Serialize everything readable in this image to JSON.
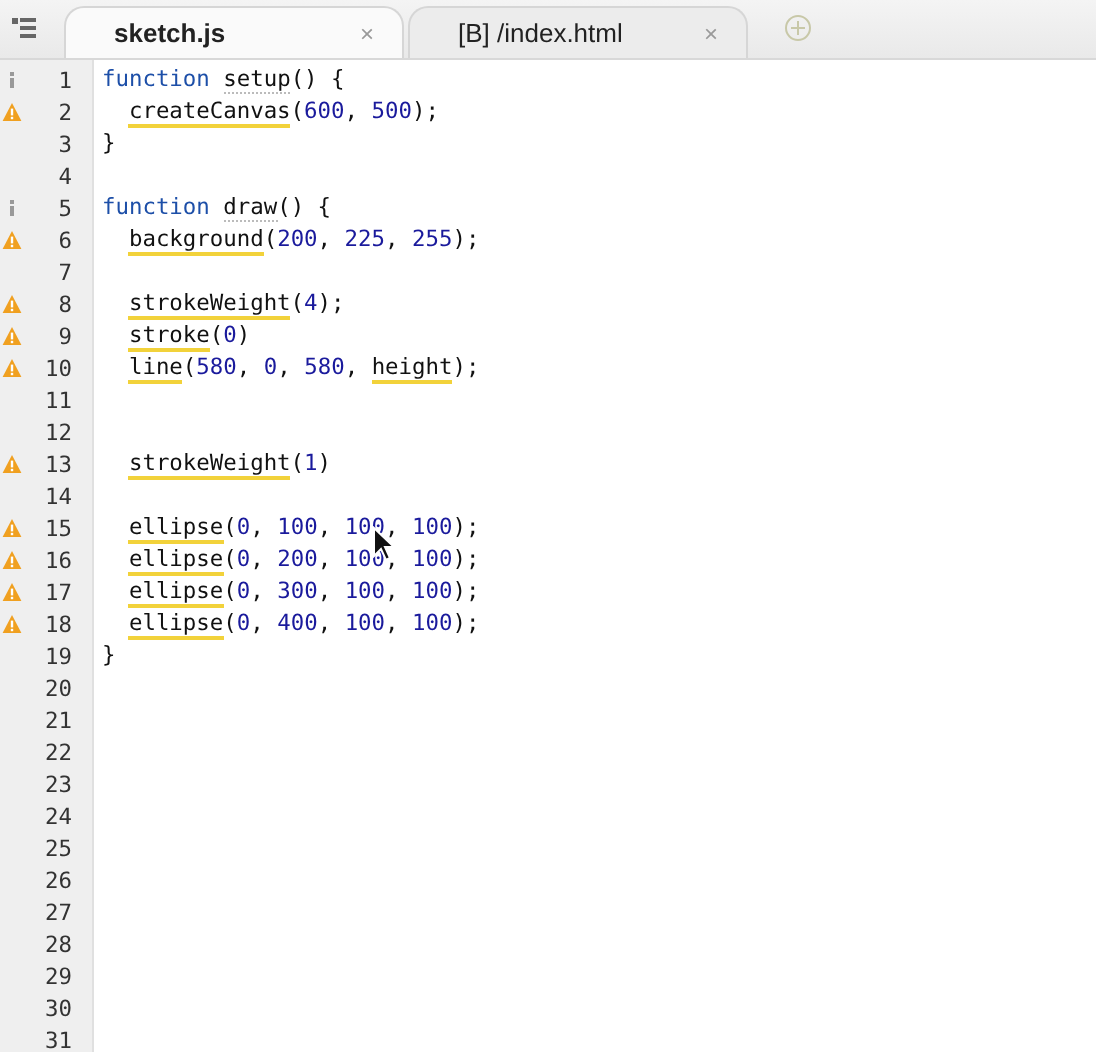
{
  "tabs": [
    {
      "label": "sketch.js",
      "selected": true,
      "close": "×"
    },
    {
      "label": "[B] /index.html",
      "selected": false,
      "close": "×"
    }
  ],
  "editor": {
    "lines": [
      {
        "number": "1",
        "info": true,
        "warning": false,
        "indent": false,
        "tokens": [
          {
            "text": "function ",
            "kind": "keyword"
          },
          {
            "text": "setup",
            "kind": "decl"
          },
          {
            "text": "() {",
            "kind": "text"
          }
        ]
      },
      {
        "number": "2",
        "info": false,
        "warning": true,
        "indent": true,
        "tokens": [
          {
            "text": "createCanvas",
            "kind": "call"
          },
          {
            "text": "(",
            "kind": "text"
          },
          {
            "text": "600",
            "kind": "number"
          },
          {
            "text": ", ",
            "kind": "text"
          },
          {
            "text": "500",
            "kind": "number"
          },
          {
            "text": ");",
            "kind": "text"
          }
        ]
      },
      {
        "number": "3",
        "info": false,
        "warning": false,
        "indent": false,
        "tokens": [
          {
            "text": "}",
            "kind": "text"
          }
        ]
      },
      {
        "number": "4",
        "info": false,
        "warning": false
      },
      {
        "number": "5",
        "info": true,
        "warning": false,
        "indent": false,
        "tokens": [
          {
            "text": "function ",
            "kind": "keyword"
          },
          {
            "text": "draw",
            "kind": "decl"
          },
          {
            "text": "() {",
            "kind": "text"
          }
        ]
      },
      {
        "number": "6",
        "info": false,
        "warning": true,
        "indent": true,
        "tokens": [
          {
            "text": "background",
            "kind": "call"
          },
          {
            "text": "(",
            "kind": "text"
          },
          {
            "text": "200",
            "kind": "number"
          },
          {
            "text": ", ",
            "kind": "text"
          },
          {
            "text": "225",
            "kind": "number"
          },
          {
            "text": ", ",
            "kind": "text"
          },
          {
            "text": "255",
            "kind": "number"
          },
          {
            "text": ");",
            "kind": "text"
          }
        ]
      },
      {
        "number": "7",
        "info": false,
        "warning": false
      },
      {
        "number": "8",
        "info": false,
        "warning": true,
        "indent": true,
        "tokens": [
          {
            "text": "strokeWeight",
            "kind": "call"
          },
          {
            "text": "(",
            "kind": "text"
          },
          {
            "text": "4",
            "kind": "number"
          },
          {
            "text": ");",
            "kind": "text"
          }
        ]
      },
      {
        "number": "9",
        "info": false,
        "warning": true,
        "indent": true,
        "tokens": [
          {
            "text": "stroke",
            "kind": "call"
          },
          {
            "text": "(",
            "kind": "text"
          },
          {
            "text": "0",
            "kind": "number"
          },
          {
            "text": ")",
            "kind": "text"
          }
        ]
      },
      {
        "number": "10",
        "info": false,
        "warning": true,
        "indent": true,
        "tokens": [
          {
            "text": "line",
            "kind": "call"
          },
          {
            "text": "(",
            "kind": "text"
          },
          {
            "text": "580",
            "kind": "number"
          },
          {
            "text": ", ",
            "kind": "text"
          },
          {
            "text": "0",
            "kind": "number"
          },
          {
            "text": ", ",
            "kind": "text"
          },
          {
            "text": "580",
            "kind": "number"
          },
          {
            "text": ", ",
            "kind": "text"
          },
          {
            "text": "height",
            "kind": "call"
          },
          {
            "text": ");",
            "kind": "text"
          }
        ]
      },
      {
        "number": "11",
        "info": false,
        "warning": false
      },
      {
        "number": "12",
        "info": false,
        "warning": false
      },
      {
        "number": "13",
        "info": false,
        "warning": true,
        "indent": true,
        "tokens": [
          {
            "text": "strokeWeight",
            "kind": "call"
          },
          {
            "text": "(",
            "kind": "text"
          },
          {
            "text": "1",
            "kind": "number"
          },
          {
            "text": ")",
            "kind": "text"
          }
        ]
      },
      {
        "number": "14",
        "info": false,
        "warning": false
      },
      {
        "number": "15",
        "info": false,
        "warning": true,
        "indent": true,
        "tokens": [
          {
            "text": "ellipse",
            "kind": "call"
          },
          {
            "text": "(",
            "kind": "text"
          },
          {
            "text": "0",
            "kind": "number"
          },
          {
            "text": ", ",
            "kind": "text"
          },
          {
            "text": "100",
            "kind": "number"
          },
          {
            "text": ", ",
            "kind": "text"
          },
          {
            "text": "100",
            "kind": "number"
          },
          {
            "text": ", ",
            "kind": "text"
          },
          {
            "text": "100",
            "kind": "number"
          },
          {
            "text": ");",
            "kind": "text"
          }
        ]
      },
      {
        "number": "16",
        "info": false,
        "warning": true,
        "indent": true,
        "tokens": [
          {
            "text": "ellipse",
            "kind": "call"
          },
          {
            "text": "(",
            "kind": "text"
          },
          {
            "text": "0",
            "kind": "number"
          },
          {
            "text": ", ",
            "kind": "text"
          },
          {
            "text": "200",
            "kind": "number"
          },
          {
            "text": ", ",
            "kind": "text"
          },
          {
            "text": "100",
            "kind": "number"
          },
          {
            "text": ", ",
            "kind": "text"
          },
          {
            "text": "100",
            "kind": "number"
          },
          {
            "text": ");",
            "kind": "text"
          }
        ]
      },
      {
        "number": "17",
        "info": false,
        "warning": true,
        "indent": true,
        "tokens": [
          {
            "text": "ellipse",
            "kind": "call"
          },
          {
            "text": "(",
            "kind": "text"
          },
          {
            "text": "0",
            "kind": "number"
          },
          {
            "text": ", ",
            "kind": "text"
          },
          {
            "text": "300",
            "kind": "number"
          },
          {
            "text": ", ",
            "kind": "text"
          },
          {
            "text": "100",
            "kind": "number"
          },
          {
            "text": ", ",
            "kind": "text"
          },
          {
            "text": "100",
            "kind": "number"
          },
          {
            "text": ");",
            "kind": "text"
          }
        ]
      },
      {
        "number": "18",
        "info": false,
        "warning": true,
        "indent": true,
        "tokens": [
          {
            "text": "ellipse",
            "kind": "call"
          },
          {
            "text": "(",
            "kind": "text"
          },
          {
            "text": "0",
            "kind": "number"
          },
          {
            "text": ", ",
            "kind": "text"
          },
          {
            "text": "400",
            "kind": "number"
          },
          {
            "text": ", ",
            "kind": "text"
          },
          {
            "text": "100",
            "kind": "number"
          },
          {
            "text": ", ",
            "kind": "text"
          },
          {
            "text": "100",
            "kind": "number"
          },
          {
            "text": ");",
            "kind": "text"
          }
        ]
      },
      {
        "number": "19",
        "info": false,
        "warning": false,
        "indent": false,
        "tokens": [
          {
            "text": "}",
            "kind": "text"
          }
        ]
      },
      {
        "number": "20",
        "info": false,
        "warning": false
      },
      {
        "number": "21",
        "info": false,
        "warning": false
      },
      {
        "number": "22",
        "info": false,
        "warning": false
      },
      {
        "number": "23",
        "info": false,
        "warning": false
      },
      {
        "number": "24",
        "info": false,
        "warning": false
      },
      {
        "number": "25",
        "info": false,
        "warning": false
      },
      {
        "number": "26",
        "info": false,
        "warning": false
      },
      {
        "number": "27",
        "info": false,
        "warning": false
      },
      {
        "number": "28",
        "info": false,
        "warning": false
      },
      {
        "number": "29",
        "info": false,
        "warning": false
      },
      {
        "number": "30",
        "info": false,
        "warning": false
      },
      {
        "number": "31",
        "info": false,
        "warning": false
      }
    ]
  }
}
